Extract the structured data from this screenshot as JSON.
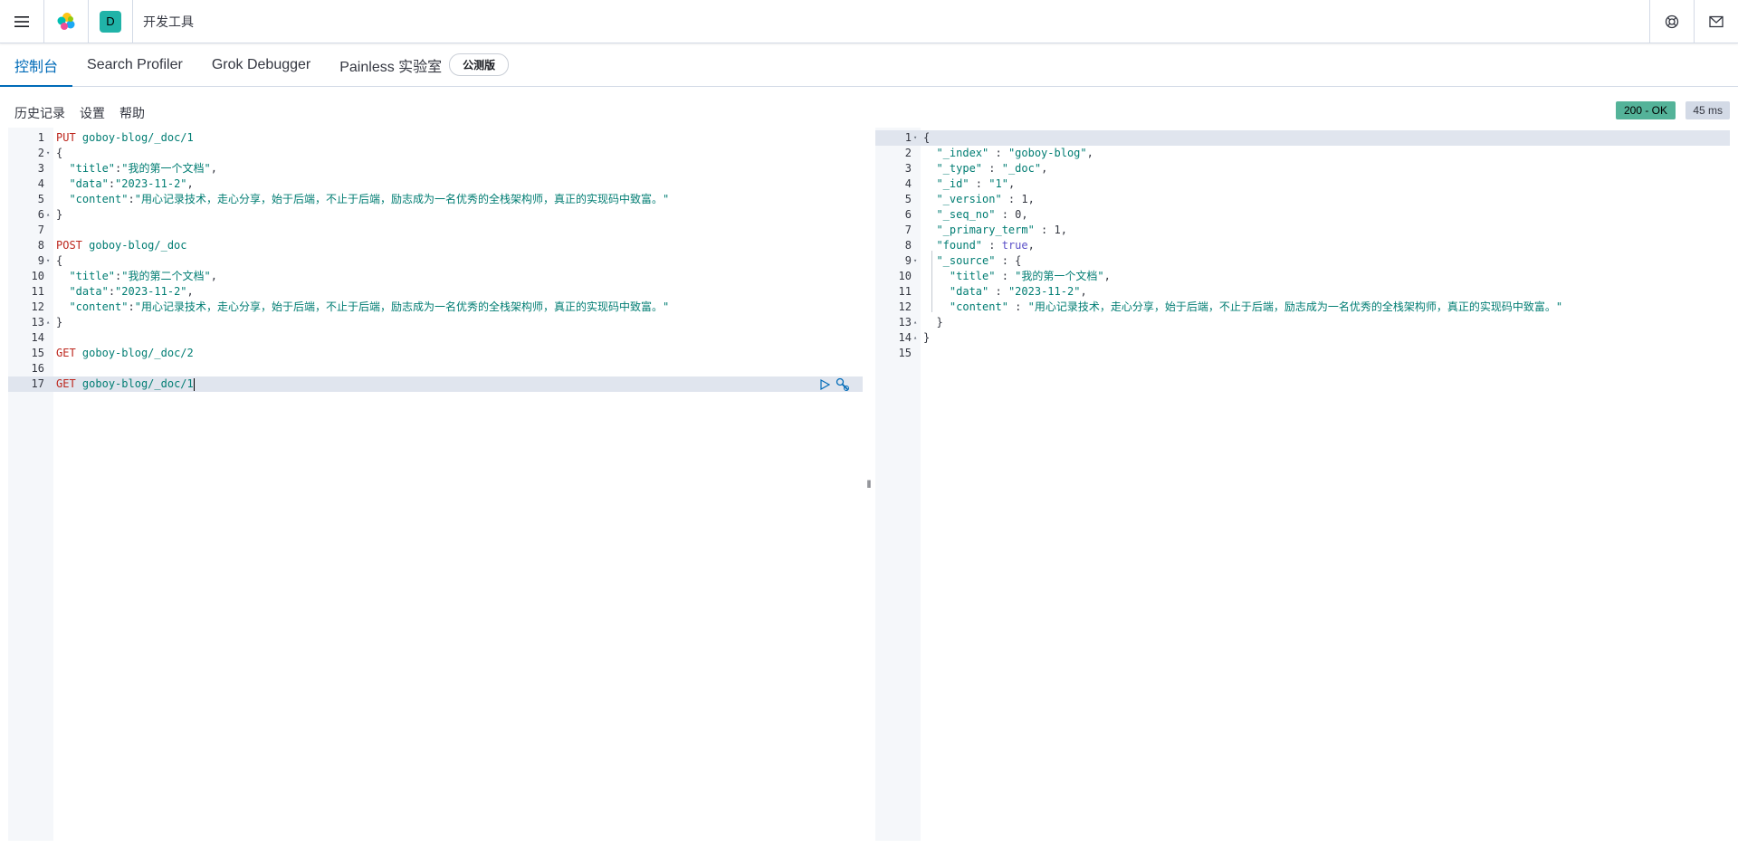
{
  "header": {
    "app_title": "开发工具",
    "space_initial": "D",
    "icons": [
      "menu-icon",
      "elastic-logo-icon",
      "help-icon",
      "mail-icon"
    ]
  },
  "tabs": [
    {
      "label": "控制台",
      "active": true
    },
    {
      "label": "Search Profiler",
      "active": false
    },
    {
      "label": "Grok Debugger",
      "active": false
    },
    {
      "label": "Painless 实验室",
      "active": false,
      "badge": "公测版"
    }
  ],
  "toolbar": {
    "history": "历史记录",
    "settings": "设置",
    "help": "帮助",
    "status": "200 - OK",
    "elapsed": "45 ms"
  },
  "request_editor": {
    "lines": [
      {
        "n": "1",
        "parts": [
          [
            "kw-method",
            "PUT"
          ],
          [
            "punc",
            " "
          ],
          [
            "url",
            "goboy-blog/_doc/1"
          ]
        ]
      },
      {
        "n": "2",
        "fold": "▾",
        "parts": [
          [
            "punc",
            "{"
          ]
        ]
      },
      {
        "n": "3",
        "parts": [
          [
            "punc",
            "  "
          ],
          [
            "key",
            "\"title\""
          ],
          [
            "punc",
            ":"
          ],
          [
            "str",
            "\"我的第一个文档\""
          ],
          [
            "punc",
            ","
          ]
        ]
      },
      {
        "n": "4",
        "parts": [
          [
            "punc",
            "  "
          ],
          [
            "key",
            "\"data\""
          ],
          [
            "punc",
            ":"
          ],
          [
            "str",
            "\"2023-11-2\""
          ],
          [
            "punc",
            ","
          ]
        ]
      },
      {
        "n": "5",
        "parts": [
          [
            "punc",
            "  "
          ],
          [
            "key",
            "\"content\""
          ],
          [
            "punc",
            ":"
          ],
          [
            "str",
            "\"用心记录技术，走心分享，始于后端，不止于后端，励志成为一名优秀的全栈架构师，真正的实现码中致富。\""
          ]
        ]
      },
      {
        "n": "6",
        "fold": "▴",
        "parts": [
          [
            "punc",
            "}"
          ]
        ]
      },
      {
        "n": "7",
        "parts": []
      },
      {
        "n": "8",
        "parts": [
          [
            "kw-method",
            "POST"
          ],
          [
            "punc",
            " "
          ],
          [
            "url",
            "goboy-blog/_doc"
          ]
        ]
      },
      {
        "n": "9",
        "fold": "▾",
        "parts": [
          [
            "punc",
            "{"
          ]
        ]
      },
      {
        "n": "10",
        "parts": [
          [
            "punc",
            "  "
          ],
          [
            "key",
            "\"title\""
          ],
          [
            "punc",
            ":"
          ],
          [
            "str",
            "\"我的第二个文档\""
          ],
          [
            "punc",
            ","
          ]
        ]
      },
      {
        "n": "11",
        "parts": [
          [
            "punc",
            "  "
          ],
          [
            "key",
            "\"data\""
          ],
          [
            "punc",
            ":"
          ],
          [
            "str",
            "\"2023-11-2\""
          ],
          [
            "punc",
            ","
          ]
        ]
      },
      {
        "n": "12",
        "parts": [
          [
            "punc",
            "  "
          ],
          [
            "key",
            "\"content\""
          ],
          [
            "punc",
            ":"
          ],
          [
            "str",
            "\"用心记录技术，走心分享，始于后端，不止于后端，励志成为一名优秀的全栈架构师，真正的实现码中致富。\""
          ]
        ]
      },
      {
        "n": "13",
        "fold": "▴",
        "parts": [
          [
            "punc",
            "}"
          ]
        ]
      },
      {
        "n": "14",
        "parts": []
      },
      {
        "n": "15",
        "parts": [
          [
            "kw-method",
            "GET"
          ],
          [
            "punc",
            " "
          ],
          [
            "url",
            "goboy-blog/_doc/2"
          ]
        ]
      },
      {
        "n": "16",
        "parts": []
      },
      {
        "n": "17",
        "active": true,
        "parts": [
          [
            "kw-method",
            "GET"
          ],
          [
            "punc",
            " "
          ],
          [
            "url",
            "goboy-blog/_doc/1"
          ]
        ]
      }
    ]
  },
  "response_editor": {
    "lines": [
      {
        "n": "1",
        "fold": "▾",
        "active": true,
        "parts": [
          [
            "punc",
            "{"
          ]
        ]
      },
      {
        "n": "2",
        "parts": [
          [
            "punc",
            "  "
          ],
          [
            "key",
            "\"_index\""
          ],
          [
            "punc",
            " : "
          ],
          [
            "str",
            "\"goboy-blog\""
          ],
          [
            "punc",
            ","
          ]
        ]
      },
      {
        "n": "3",
        "parts": [
          [
            "punc",
            "  "
          ],
          [
            "key",
            "\"_type\""
          ],
          [
            "punc",
            " : "
          ],
          [
            "str",
            "\"_doc\""
          ],
          [
            "punc",
            ","
          ]
        ]
      },
      {
        "n": "4",
        "parts": [
          [
            "punc",
            "  "
          ],
          [
            "key",
            "\"_id\""
          ],
          [
            "punc",
            " : "
          ],
          [
            "str",
            "\"1\""
          ],
          [
            "punc",
            ","
          ]
        ]
      },
      {
        "n": "5",
        "parts": [
          [
            "punc",
            "  "
          ],
          [
            "key",
            "\"_version\""
          ],
          [
            "punc",
            " : "
          ],
          [
            "num",
            "1"
          ],
          [
            "punc",
            ","
          ]
        ]
      },
      {
        "n": "6",
        "parts": [
          [
            "punc",
            "  "
          ],
          [
            "key",
            "\"_seq_no\""
          ],
          [
            "punc",
            " : "
          ],
          [
            "num",
            "0"
          ],
          [
            "punc",
            ","
          ]
        ]
      },
      {
        "n": "7",
        "parts": [
          [
            "punc",
            "  "
          ],
          [
            "key",
            "\"_primary_term\""
          ],
          [
            "punc",
            " : "
          ],
          [
            "num",
            "1"
          ],
          [
            "punc",
            ","
          ]
        ]
      },
      {
        "n": "8",
        "parts": [
          [
            "punc",
            "  "
          ],
          [
            "key",
            "\"found\""
          ],
          [
            "punc",
            " : "
          ],
          [
            "bool",
            "true"
          ],
          [
            "punc",
            ","
          ]
        ]
      },
      {
        "n": "9",
        "fold": "▾",
        "parts": [
          [
            "punc",
            "  "
          ],
          [
            "key",
            "\"_source\""
          ],
          [
            "punc",
            " : {"
          ]
        ]
      },
      {
        "n": "10",
        "parts": [
          [
            "punc",
            "    "
          ],
          [
            "key",
            "\"title\""
          ],
          [
            "punc",
            " : "
          ],
          [
            "str",
            "\"我的第一个文档\""
          ],
          [
            "punc",
            ","
          ]
        ]
      },
      {
        "n": "11",
        "parts": [
          [
            "punc",
            "    "
          ],
          [
            "key",
            "\"data\""
          ],
          [
            "punc",
            " : "
          ],
          [
            "str",
            "\"2023-11-2\""
          ],
          [
            "punc",
            ","
          ]
        ]
      },
      {
        "n": "12",
        "parts": [
          [
            "punc",
            "    "
          ],
          [
            "key",
            "\"content\""
          ],
          [
            "punc",
            " : "
          ],
          [
            "str",
            "\"用心记录技术，走心分享，始于后端，不止于后端，励志成为一名优秀的全栈架构师，真正的实现码中致富。\""
          ]
        ]
      },
      {
        "n": "13",
        "fold": "▴",
        "parts": [
          [
            "punc",
            "  }"
          ]
        ]
      },
      {
        "n": "14",
        "fold": "▴",
        "parts": [
          [
            "punc",
            "}"
          ]
        ]
      },
      {
        "n": "15",
        "parts": []
      }
    ]
  }
}
